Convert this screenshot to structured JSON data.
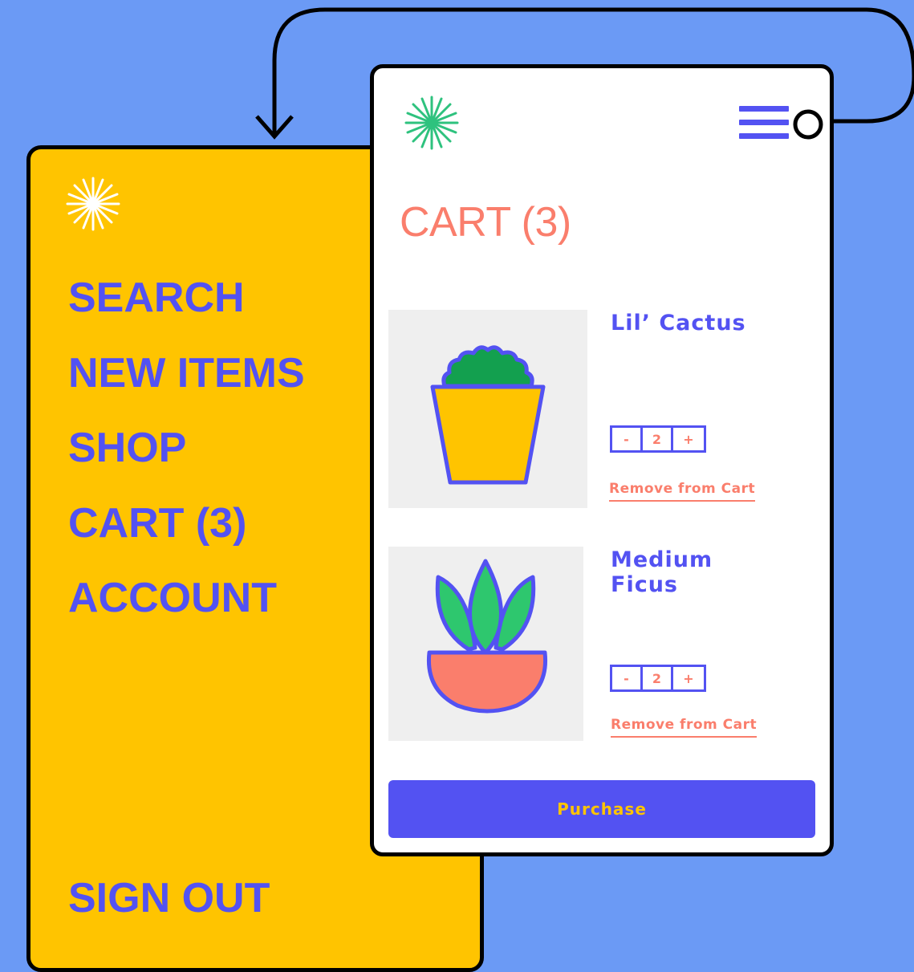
{
  "colors": {
    "background": "#6B9AF5",
    "menu_bg": "#FFC400",
    "accent_blue": "#5352F2",
    "accent_coral": "#FA7E6C",
    "logo_green": "#2EC27E",
    "cactus_green": "#13A04F",
    "leaf_green": "#2EC76E"
  },
  "menu": {
    "logo_icon": "sparkle-icon",
    "items": [
      {
        "label": "SEARCH"
      },
      {
        "label": "NEW ITEMS"
      },
      {
        "label": "SHOP"
      },
      {
        "label": "CART (3)"
      },
      {
        "label": "ACCOUNT"
      }
    ],
    "sign_out": "SIGN OUT"
  },
  "cart": {
    "logo_icon": "sparkle-icon",
    "menu_icon": "hamburger-icon",
    "title": "CART (3)",
    "items": [
      {
        "name": "Lil’ Cactus",
        "quantity": "2",
        "decrement": "-",
        "increment": "+",
        "remove_label": "Remove from Cart",
        "image_icon": "cactus-pot-icon"
      },
      {
        "name": "Medium Ficus",
        "quantity": "2",
        "decrement": "-",
        "increment": "+",
        "remove_label": "Remove from Cart",
        "image_icon": "ficus-pot-icon"
      }
    ],
    "purchase_label": "Purchase"
  }
}
